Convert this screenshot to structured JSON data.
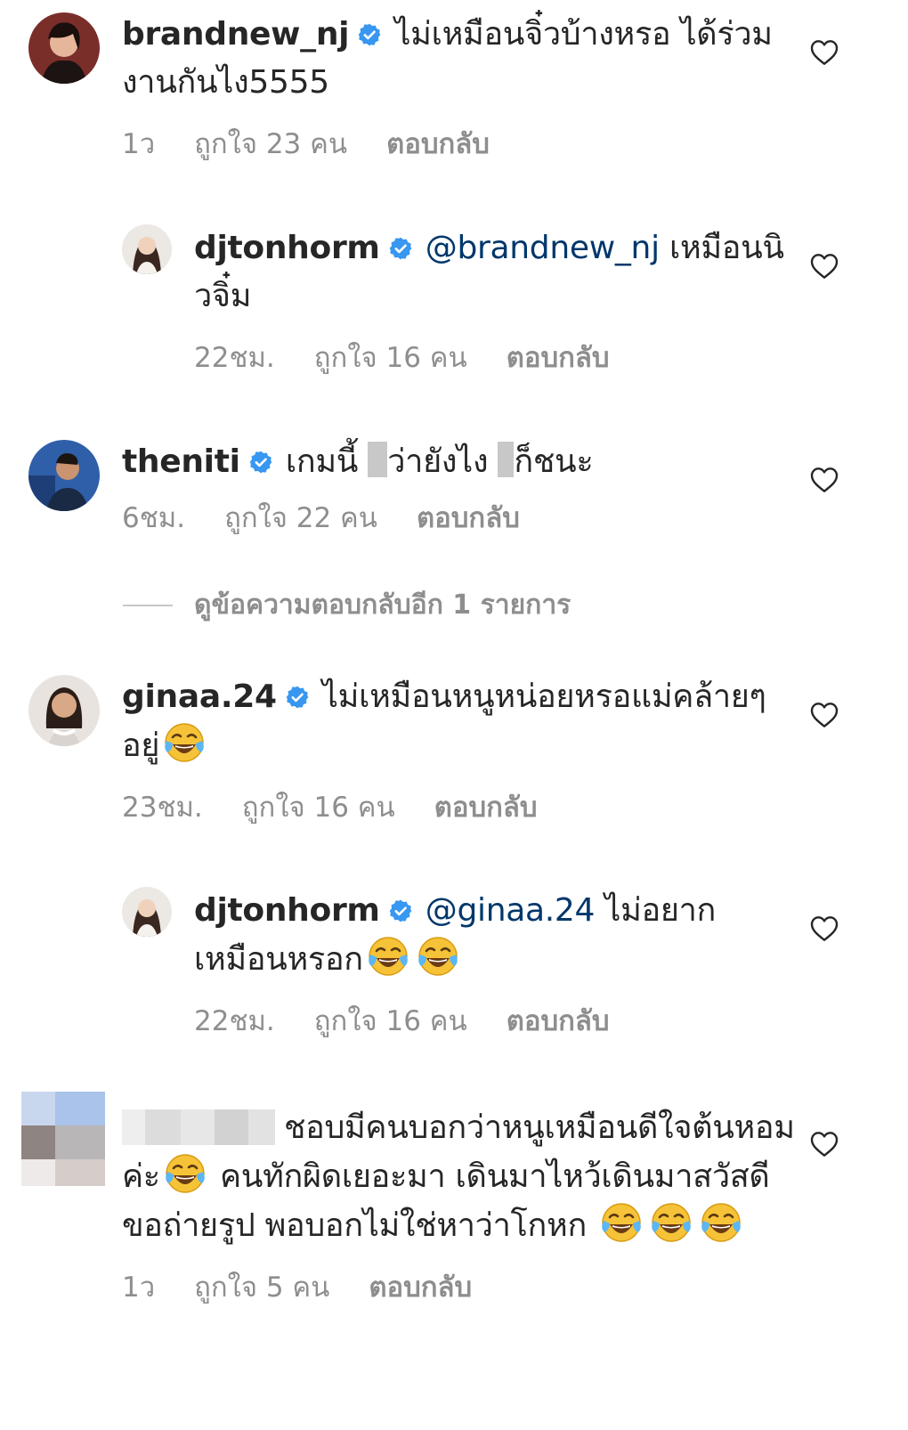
{
  "comments": [
    {
      "username": "brandnew_nj",
      "text": "ไม่เหมือนจิ๋วบ้างหรอ ได้ร่วมงานกันไง5555",
      "time": "1ว",
      "likes": "ถูกใจ 23 คน",
      "reply": "ตอบกลับ"
    },
    {
      "username": "djtonhorm",
      "mention": "@brandnew_nj",
      "text": "เหมือนนิวจิ๋ม",
      "time": "22ชม.",
      "likes": "ถูกใจ 16 คน",
      "reply": "ตอบกลับ"
    },
    {
      "username": "theniti",
      "text_a": "เกมนี้",
      "text_b": "ว่ายังไง",
      "text_c": "ก็ชนะ",
      "time": "6ชม.",
      "likes": "ถูกใจ 22 คน",
      "reply": "ตอบกลับ"
    },
    {
      "username": "ginaa.24",
      "text": "ไม่เหมือนหนูหน่อยหรอแม่คล้ายๆอยู่",
      "time": "23ชม.",
      "likes": "ถูกใจ 16 คน",
      "reply": "ตอบกลับ"
    },
    {
      "username": "djtonhorm",
      "mention": "@ginaa.24",
      "text": "ไม่อยากเหมือนหรอก",
      "time": "22ชม.",
      "likes": "ถูกใจ 16 คน",
      "reply": "ตอบกลับ"
    },
    {
      "username": "",
      "text_a": "ชอบมีคนบอกว่าหนูเหมือนดีใจต้นหอมค่ะ",
      "text_b": "คนทักผิดเยอะมา เดินมาไหว้เดินมาสวัสดี ขอถ่ายรูป พอบอกไม่ใช่หาว่าโกหก",
      "time": "1ว",
      "likes": "ถูกใจ 5 คน",
      "reply": "ตอบกลับ"
    }
  ],
  "view_more_replies": "ดูข้อความตอบกลับอีก 1 รายการ",
  "colors": {
    "text": "#262626",
    "meta": "#8e8e8e",
    "mention": "#00376b",
    "verified": "#3897f0"
  },
  "icons": {
    "verified": "verified-badge-icon",
    "like": "heart-outline-icon",
    "emoji": "face-with-tears-of-joy-emoji"
  }
}
